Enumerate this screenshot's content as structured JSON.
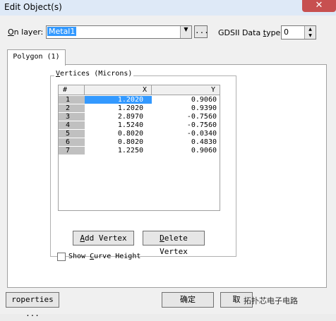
{
  "window": {
    "title": "Edit Object(s)"
  },
  "form": {
    "on_layer_label_ul": "O",
    "on_layer_label_rest": "n layer:",
    "layer_value": "Metal1",
    "browse_label": "...",
    "gds_label_pre": "GDSII Data ",
    "gds_label_ul": "t",
    "gds_label_post": "ype:",
    "gds_value": "0"
  },
  "tab": {
    "label": "Polygon (1)"
  },
  "vertices": {
    "group_title_ul": "V",
    "group_title_rest": "ertices (Microns)",
    "columns": [
      "#",
      "X",
      "Y"
    ],
    "rows": [
      {
        "n": "1",
        "x": "1.2020",
        "y": "0.9060"
      },
      {
        "n": "2",
        "x": "1.2020",
        "y": "0.9390"
      },
      {
        "n": "3",
        "x": "2.8970",
        "y": "-0.7560"
      },
      {
        "n": "4",
        "x": "1.5240",
        "y": "-0.7560"
      },
      {
        "n": "5",
        "x": "0.8020",
        "y": "-0.0340"
      },
      {
        "n": "6",
        "x": "0.8020",
        "y": "0.4830"
      },
      {
        "n": "7",
        "x": "1.2250",
        "y": "0.9060"
      }
    ],
    "add_ul": "A",
    "add_rest": "dd Vertex",
    "delete_ul": "D",
    "delete_rest": "elete Vertex",
    "show_curve_pre": "Show ",
    "show_curve_ul": "C",
    "show_curve_post": "urve Height"
  },
  "buttons": {
    "properties": "roperties ...",
    "ok": "确定",
    "cancel": "取"
  },
  "watermark": "拓扑芯电子电路"
}
